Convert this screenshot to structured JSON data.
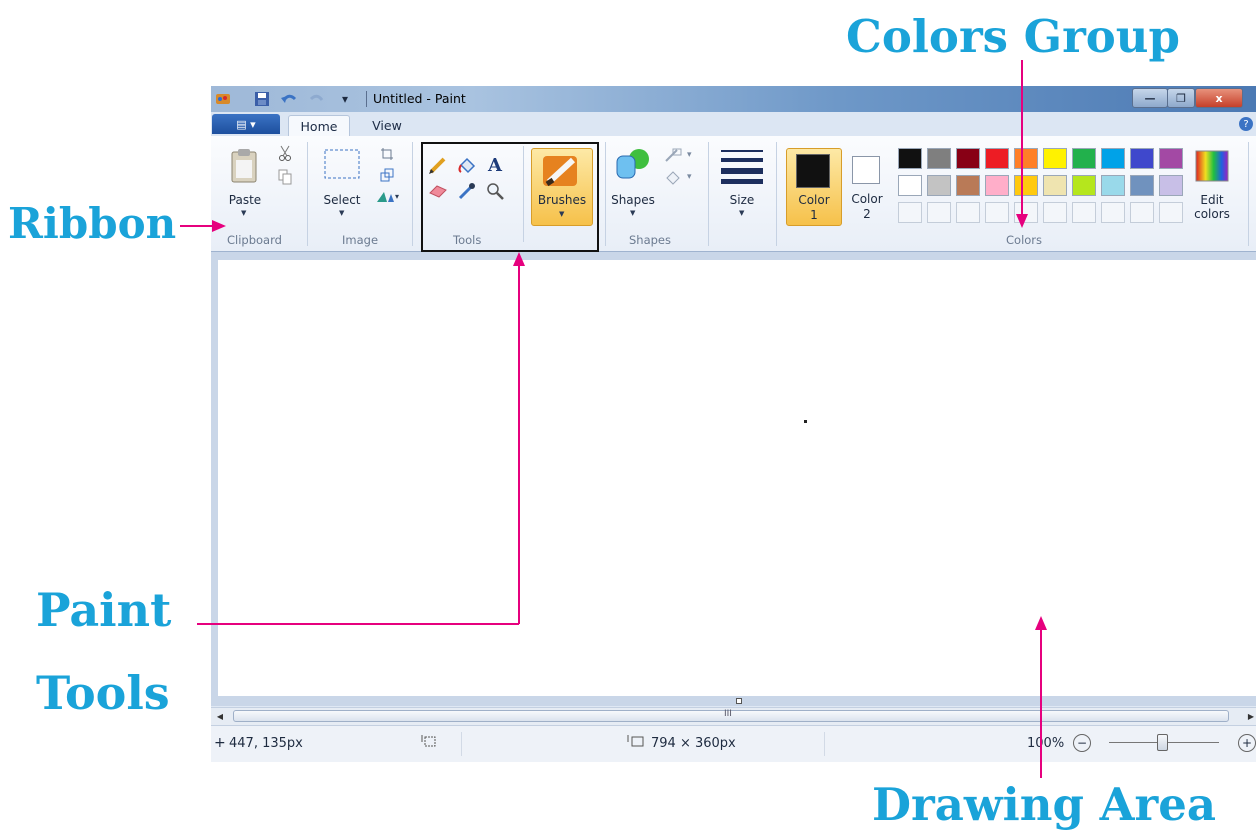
{
  "callouts": {
    "colors_group": "Colors Group",
    "ribbon": "Ribbon",
    "paint": "Paint",
    "tools": "Tools",
    "drawing_area": "Drawing Area"
  },
  "window": {
    "title": "Untitled - Paint",
    "minimize": "—",
    "maximize": "❐",
    "close": "x",
    "help": "?"
  },
  "tabs": {
    "file": "▤ ▾",
    "home": "Home",
    "view": "View"
  },
  "ribbon": {
    "clipboard": {
      "paste": "Paste",
      "group": "Clipboard"
    },
    "image": {
      "select": "Select",
      "group": "Image"
    },
    "tools": {
      "group": "Tools",
      "text_icon": "A"
    },
    "brushes": {
      "label": "Brushes"
    },
    "shapes": {
      "label": "Shapes",
      "group": "Shapes"
    },
    "size": {
      "label": "Size"
    },
    "color1": {
      "line1": "Color",
      "line2": "1"
    },
    "color2": {
      "line1": "Color",
      "line2": "2"
    },
    "colors": {
      "group": "Colors"
    },
    "edit_colors": {
      "line1": "Edit",
      "line2": "colors"
    }
  },
  "palette": {
    "row1": [
      "#111111",
      "#7f7f7f",
      "#880015",
      "#ed1c24",
      "#ff7f27",
      "#fff200",
      "#22b14c",
      "#00a2e8",
      "#3f48cc",
      "#a349a4"
    ],
    "row2": [
      "#ffffff",
      "#c3c3c3",
      "#b97a57",
      "#ffaec9",
      "#ffc90e",
      "#efe4b0",
      "#b5e61d",
      "#99d9ea",
      "#7092be",
      "#c8bfe7"
    ],
    "color1": "#111111",
    "color2": "#ffffff"
  },
  "scrollbar": {
    "grip": "III"
  },
  "status": {
    "cursor_pos": "447, 135px",
    "canvas_size": "794 × 360px",
    "zoom": "100%",
    "zoom_out": "−",
    "zoom_in": "+"
  },
  "colors": {
    "accent": "#1aa3d9",
    "arrow": "#e6007e"
  }
}
